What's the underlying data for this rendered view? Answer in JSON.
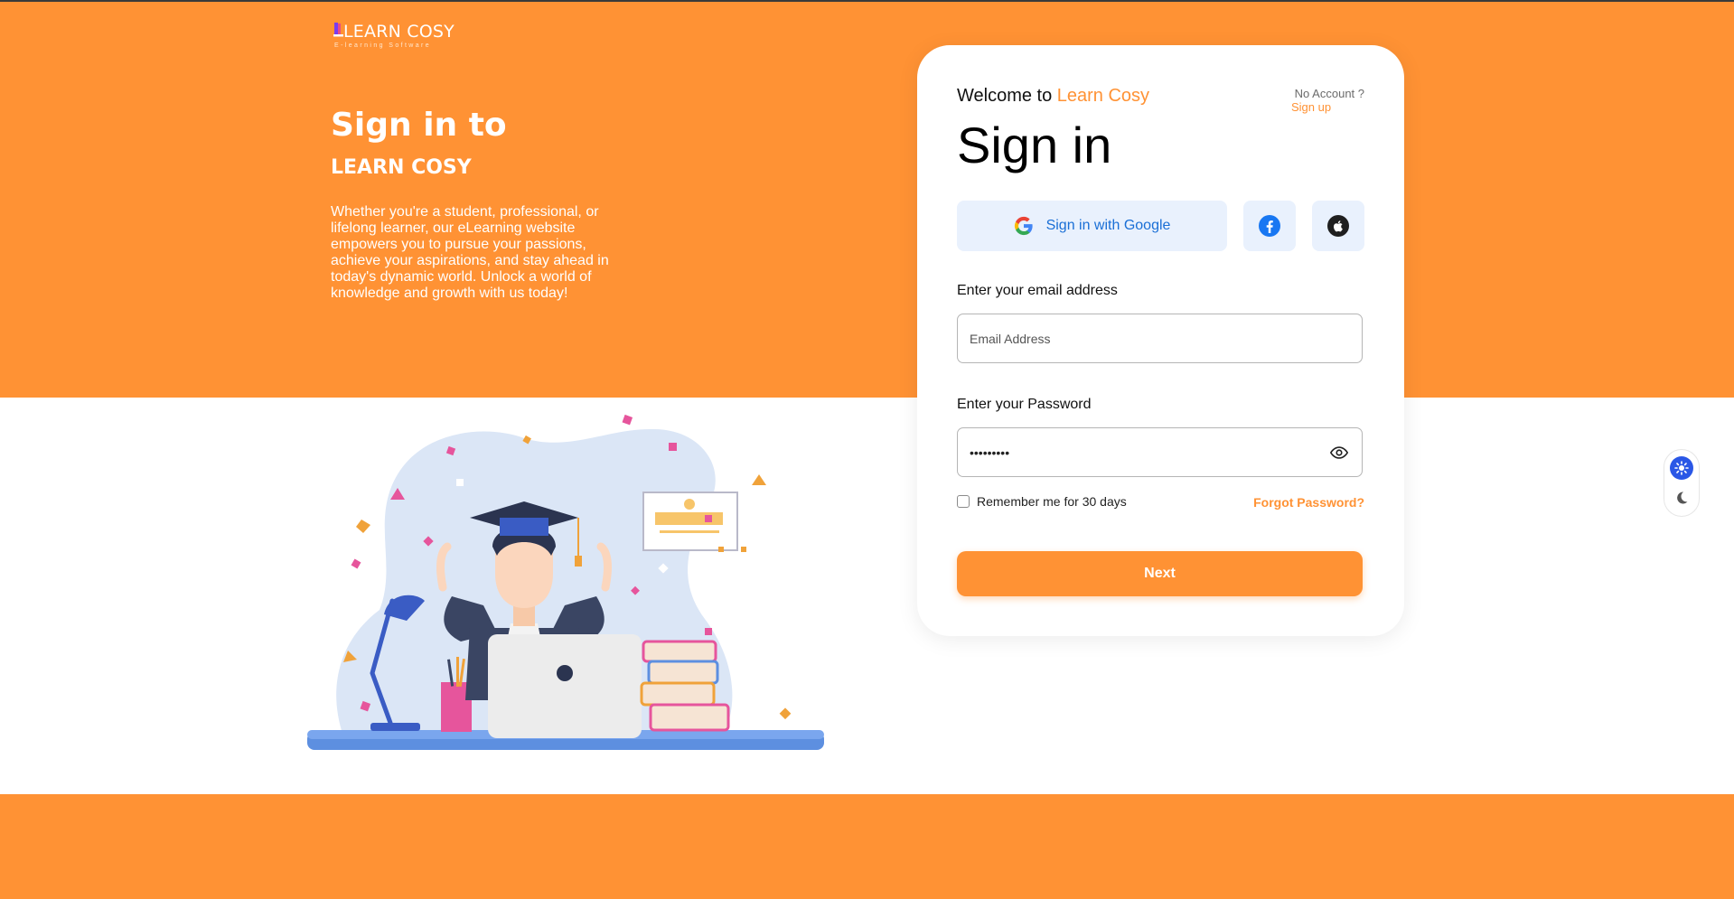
{
  "brand": {
    "logo_text": "LEARN COSY",
    "logo_tagline": "E-learning Software"
  },
  "hero": {
    "title": "Sign in to",
    "subtitle": "LEARN COSY",
    "description": "Whether you're a student, professional, or lifelong learner, our eLearning website empowers you to pursue your passions, achieve your aspirations, and stay ahead in today's dynamic world. Unlock a world of knowledge and growth with us today!"
  },
  "card": {
    "welcome_prefix": "Welcome to ",
    "welcome_brand": "Learn Cosy",
    "no_account": "No Account ?",
    "signup": "Sign up",
    "title": "Sign in",
    "google_label": "Sign in with Google",
    "email_label": "Enter your email address",
    "email_placeholder": "Email Address",
    "email_value": "",
    "password_label": "Enter your Password",
    "password_value": "password1",
    "remember_label": "Remember me for 30 days",
    "remember_checked": false,
    "forgot": "Forgot Password?",
    "next": "Next"
  },
  "icons": {
    "google": "google-icon",
    "facebook": "facebook-icon",
    "apple": "apple-icon",
    "eye": "eye-icon",
    "light_mode": "sun-icon",
    "dark_mode": "moon-icon"
  },
  "colors": {
    "accent": "#ff9234",
    "link_blue": "#1a6fd6",
    "toggle_blue": "#2a57e6"
  }
}
